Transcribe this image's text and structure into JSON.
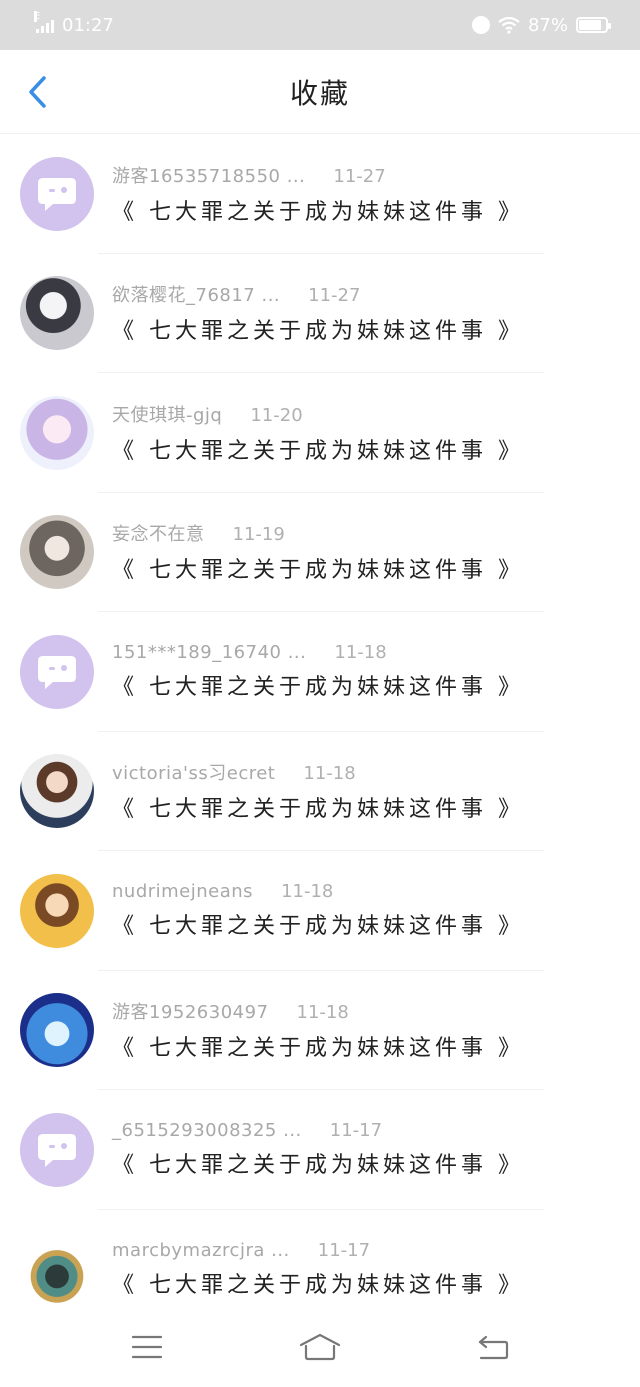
{
  "status_bar": {
    "network": "E",
    "time": "01:27",
    "battery": "87%",
    "battery_level": 0.87,
    "icons": [
      "signal-icon",
      "alarm-icon",
      "wifi-icon",
      "battery-icon"
    ]
  },
  "header": {
    "title": "收藏",
    "back_icon": "chevron-left-icon",
    "accent_color": "#3a8ee6"
  },
  "items": [
    {
      "name": "游客16535718550 ...",
      "date": "11-27",
      "title": "《 七大罪之关于成为妹妹这件事 》",
      "avatar": "default-avatar"
    },
    {
      "name": "欲落樱花_76817 ...",
      "date": "11-27",
      "title": "《 七大罪之关于成为妹妹这件事 》",
      "avatar": "photo-avatar"
    },
    {
      "name": "天使琪琪-gjq",
      "date": "11-20",
      "title": "《 七大罪之关于成为妹妹这件事 》",
      "avatar": "photo-avatar"
    },
    {
      "name": "妄念不在意",
      "date": "11-19",
      "title": "《 七大罪之关于成为妹妹这件事 》",
      "avatar": "photo-avatar"
    },
    {
      "name": "151***189_16740 ...",
      "date": "11-18",
      "title": "《 七大罪之关于成为妹妹这件事 》",
      "avatar": "default-avatar"
    },
    {
      "name": "victoria'ss习ecret",
      "date": "11-18",
      "title": "《 七大罪之关于成为妹妹这件事 》",
      "avatar": "photo-avatar"
    },
    {
      "name": "nudrimejneans",
      "date": "11-18",
      "title": "《 七大罪之关于成为妹妹这件事 》",
      "avatar": "photo-avatar"
    },
    {
      "name": "游客1952630497",
      "date": "11-18",
      "title": "《 七大罪之关于成为妹妹这件事 》",
      "avatar": "photo-avatar"
    },
    {
      "name": "_6515293008325 ...",
      "date": "11-17",
      "title": "《 七大罪之关于成为妹妹这件事 》",
      "avatar": "default-avatar"
    },
    {
      "name": "marcbymazrcjra ...",
      "date": "11-17",
      "title": "《 七大罪之关于成为妹妹这件事 》",
      "avatar": "photo-avatar"
    }
  ],
  "nav_bar": {
    "icons": [
      "menu-icon",
      "home-icon",
      "back-icon"
    ]
  },
  "colors": {
    "status_bar_bg": "#dcdcdc",
    "default_avatar_bg": "#d2c2ee",
    "meta_text": "#a8a8a8"
  }
}
